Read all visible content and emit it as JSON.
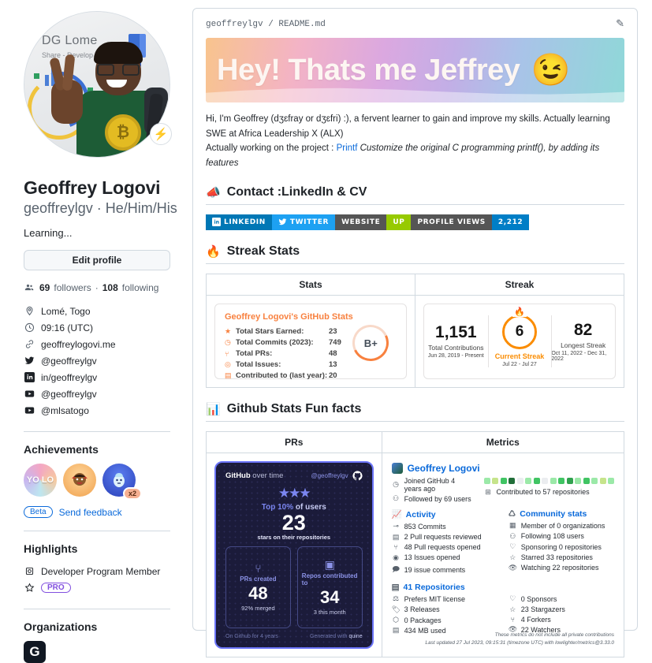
{
  "profile": {
    "avatar": {
      "backdrop_title": "DG Lome",
      "backdrop_sub": "Share - Develop",
      "status_icon": "lightning-icon"
    },
    "name": "Geoffrey Logovi",
    "handle": "geoffreylgv",
    "pronouns": "He/Him/His",
    "bio": "Learning...",
    "edit_label": "Edit profile",
    "followers_count": "69",
    "followers_label": "followers",
    "following_count": "108",
    "following_label": "following",
    "meta": [
      {
        "icon": "location-icon",
        "text": "Lomé, Togo"
      },
      {
        "icon": "clock-icon",
        "text": "09:16 (UTC)"
      },
      {
        "icon": "link-icon",
        "text": "geoffreylogovi.me"
      },
      {
        "icon": "twitter-icon",
        "text": "@geoffreylgv"
      },
      {
        "icon": "linkedin-icon",
        "text": "in/geoffreylgv"
      },
      {
        "icon": "youtube-icon",
        "text": "@geoffreylgv"
      },
      {
        "icon": "youtube-icon",
        "text": "@mlsatogo"
      }
    ],
    "achievements": {
      "title": "Achievements",
      "items": [
        {
          "name": "yolo-achievement",
          "label": "YO LO"
        },
        {
          "name": "quickdraw-achievement",
          "label": ""
        },
        {
          "name": "pair-extraordinaire-achievement",
          "label": "",
          "multiplier": "x2"
        }
      ],
      "beta_label": "Beta",
      "feedback_label": "Send feedback"
    },
    "highlights": {
      "title": "Highlights",
      "items": [
        {
          "icon": "developer-program-icon",
          "text": "Developer Program Member"
        },
        {
          "icon": "star-icon",
          "text": "PRO"
        }
      ]
    },
    "organizations": {
      "title": "Organizations",
      "items": [
        {
          "name": "org-avatar",
          "glyph": "G"
        }
      ]
    }
  },
  "readme": {
    "breadcrumb": "geoffreylgv / README.md",
    "edit_icon": "pencil-icon",
    "banner": {
      "title": "Hey! Thats me Jeffrey",
      "emoji": "😉"
    },
    "intro_line1": "Hi, I'm Geoffrey (dʒɛfray or dʒɛfri) :), a fervent learner to gain and improve my skills. Actually learning SWE at Africa Leadership X (ALX)",
    "intro_line2_prefix": "Actually working on the project : ",
    "intro_link": "Printf",
    "intro_line2_italic": " Customize the original C programming printf(), by adding its features",
    "contact": {
      "heading": "Contact :LinkedIn & CV",
      "emoji": "📣",
      "badges": [
        {
          "name": "linkedin-badge",
          "label": "LINKEDIN",
          "icon": "linkedin-icon",
          "color": "#0077b5"
        },
        {
          "name": "twitter-badge",
          "label": "TWITTER",
          "icon": "twitter-icon",
          "color": "#1da1f2"
        },
        {
          "name": "website-badge",
          "label": "WEBSITE",
          "value": "UP",
          "color": "#555555",
          "value_color": "#97ca00"
        },
        {
          "name": "profile-views-badge",
          "label": "PROFILE VIEWS",
          "value": "2,212",
          "color": "#555555",
          "value_color": "#007ec6"
        }
      ]
    },
    "streak_section": {
      "heading": "Streak Stats",
      "emoji": "🔥",
      "columns": [
        "Stats",
        "Streak"
      ],
      "stats_card": {
        "title": "Geoffrey Logovi's GitHub Stats",
        "rows": [
          {
            "icon": "star-icon",
            "label": "Total Stars Earned:",
            "value": "23"
          },
          {
            "icon": "history-icon",
            "label": "Total Commits (2023):",
            "value": "749"
          },
          {
            "icon": "pull-request-icon",
            "label": "Total PRs:",
            "value": "48"
          },
          {
            "icon": "issue-icon",
            "label": "Total Issues:",
            "value": "13"
          },
          {
            "icon": "repo-icon",
            "label": "Contributed to (last year):",
            "value": "20"
          }
        ],
        "rank": "B+"
      },
      "streak_card": [
        {
          "name": "total-contributions",
          "value": "1,151",
          "caption": "Total Contributions",
          "dates": "Jun 28, 2019 - Present"
        },
        {
          "name": "current-streak",
          "value": "6",
          "caption": "Current Streak",
          "dates": "Jul 22 - Jul 27"
        },
        {
          "name": "longest-streak",
          "value": "82",
          "caption": "Longest Streak",
          "dates": "Oct 11, 2022 - Dec 31, 2022"
        }
      ]
    },
    "funfacts_section": {
      "heading": "Github Stats Fun facts",
      "emoji": "📊",
      "columns": [
        "PRs",
        "Metrics"
      ],
      "quine_card": {
        "brand": "GitHub",
        "brand_rest": " over time",
        "user": "@geoffreylgv",
        "github_icon": "github-mark-icon",
        "stars_icon": "stars-icon",
        "top_prefix": "Top 10%",
        "top_suffix": " of users",
        "headline": "23",
        "headline_sub": "stars on their repositories",
        "boxes": [
          {
            "name": "prs-created-box",
            "icon": "pull-request-icon",
            "label": "PRs created",
            "value": "48",
            "note": "92% merged"
          },
          {
            "name": "repos-contributed-box",
            "icon": "book-icon",
            "label": "Repos contributed to",
            "value": "34",
            "note": "3 this month"
          }
        ],
        "footer_left": "On Github for 4 years",
        "footer_right": "Generated with",
        "footer_brand": "quine"
      },
      "metrics_card": {
        "name": "Geoffrey Logovi",
        "joined": "Joined GitHub 4 years ago",
        "followed": "Followed by 69 users",
        "calendar": [
          "#9be9a8",
          "#c6e48b",
          "#40c463",
          "#216e39",
          "#ebedf0",
          "#9be9a8",
          "#40c463",
          "#ebedf0",
          "#9be9a8",
          "#40c463",
          "#30a14e",
          "#9be9a8",
          "#40c463",
          "#9be9a8",
          "#c6e48b",
          "#9be9a8"
        ],
        "contributed": "Contributed to 57 repositories",
        "activity": {
          "heading": "Activity",
          "icon": "activity-icon",
          "rows": [
            {
              "icon": "commit-icon",
              "text": "853 Commits"
            },
            {
              "icon": "review-icon",
              "text": "2 Pull requests reviewed"
            },
            {
              "icon": "pull-request-icon",
              "text": "48 Pull requests opened"
            },
            {
              "icon": "issue-icon",
              "text": "13 Issues opened"
            },
            {
              "icon": "comment-icon",
              "text": "19 issue comments"
            }
          ]
        },
        "community": {
          "heading": "Community stats",
          "icon": "community-icon",
          "rows": [
            {
              "icon": "organization-icon",
              "text": "Member of 0 organizations"
            },
            {
              "icon": "people-icon",
              "text": "Following 108 users"
            },
            {
              "icon": "heart-icon",
              "text": "Sponsoring 0 repositories"
            },
            {
              "icon": "star-icon",
              "text": "Starred 33 repositories"
            },
            {
              "icon": "eye-icon",
              "text": "Watching 22 repositories"
            }
          ]
        },
        "repositories": {
          "heading": "41 Repositories",
          "icon": "repo-icon",
          "left_rows": [
            {
              "icon": "law-icon",
              "text": "Prefers MIT license"
            },
            {
              "icon": "tag-icon",
              "text": "3 Releases"
            },
            {
              "icon": "package-icon",
              "text": "0 Packages"
            },
            {
              "icon": "database-icon",
              "text": "434 MB used"
            }
          ],
          "right_rows": [
            {
              "icon": "heart-icon",
              "text": "0 Sponsors"
            },
            {
              "icon": "star-icon",
              "text": "23 Stargazers"
            },
            {
              "icon": "fork-icon",
              "text": "4 Forkers"
            },
            {
              "icon": "eye-icon",
              "text": "22 Watchers"
            }
          ]
        },
        "footer_line1": "These metrics do not include all private contributions",
        "footer_line2": "Last updated 27 Jul 2023, 09:15:31 (timezone UTC) with lowlighter/metrics@3.33.0"
      }
    }
  }
}
